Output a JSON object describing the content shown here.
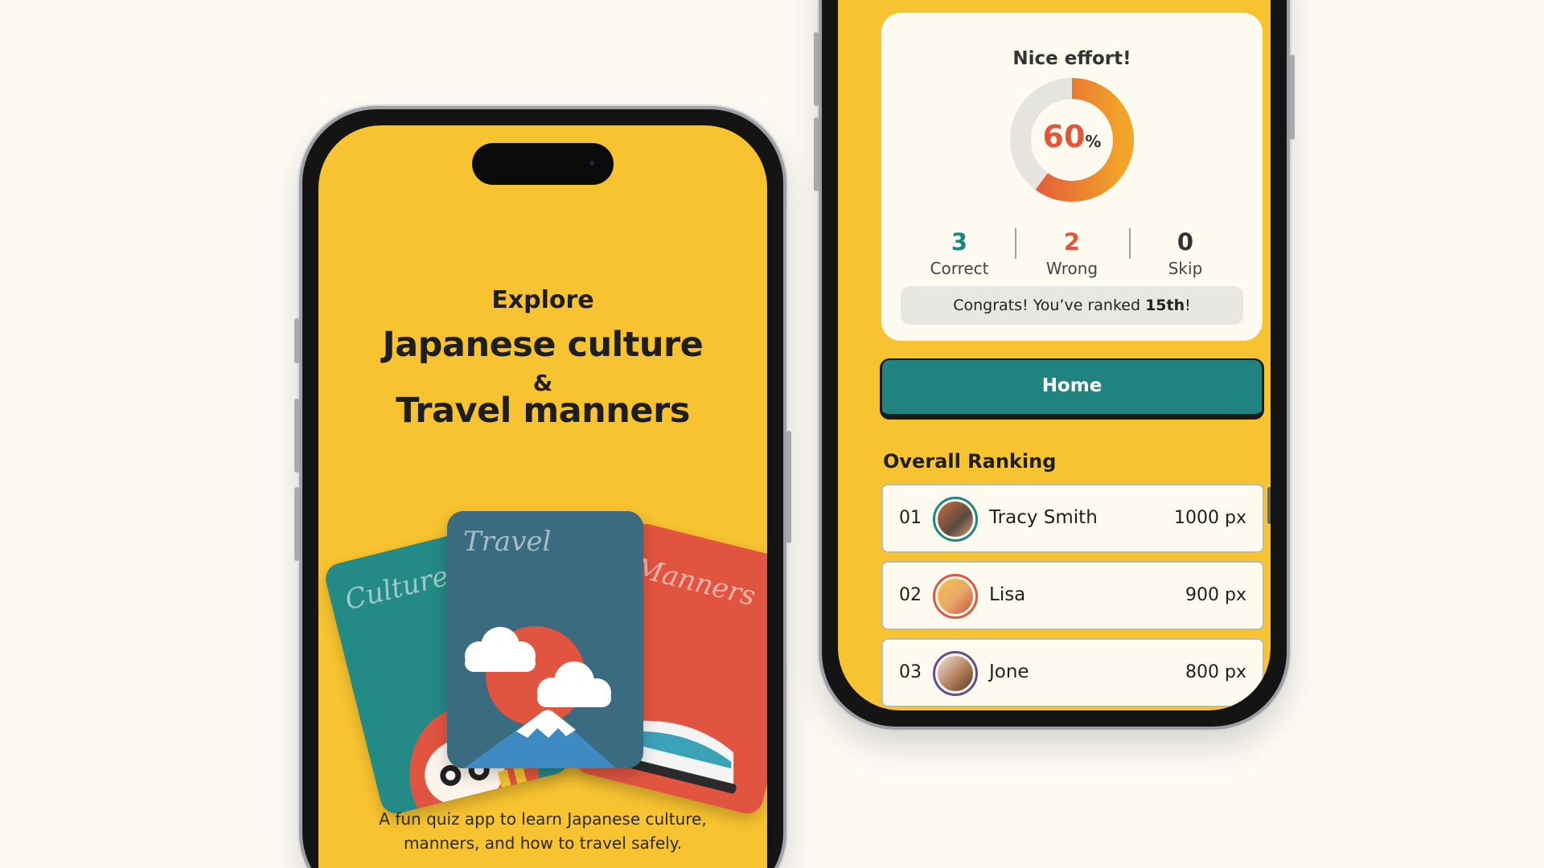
{
  "intro": {
    "line1": "Explore",
    "line2": "Japanese culture",
    "amp": "&",
    "line3": "Travel manners",
    "tagline_1": "A fun quiz app to learn Japanese culture,",
    "tagline_2": "manners, and how to travel safely."
  },
  "cards": [
    {
      "title": "Cultures",
      "color": "#238a85"
    },
    {
      "title": "Travel",
      "color": "#3a6b80"
    },
    {
      "title": "Manners",
      "color": "#e15440"
    }
  ],
  "result": {
    "title": "Nice effort!",
    "score": 60,
    "score_text": "60",
    "score_unit": "%",
    "stats": [
      {
        "value": "3",
        "label": "Correct",
        "color": "#1f8580"
      },
      {
        "value": "2",
        "label": "Wrong",
        "color": "#e2573c"
      },
      {
        "value": "0",
        "label": "Skip",
        "color": "#333333"
      }
    ],
    "congrats_prefix": "Congrats! You’ve ranked ",
    "congrats_rank": "15th",
    "congrats_suffix": "!"
  },
  "home_button": "Home",
  "ranking": {
    "title": "Overall Ranking",
    "rows": [
      {
        "rank": "01",
        "name": "Tracy Smith",
        "score": "1000 px",
        "ring": "#1f8580"
      },
      {
        "rank": "02",
        "name": "Lisa",
        "score": "900 px",
        "ring": "#e2573c"
      },
      {
        "rank": "03",
        "name": "Jone",
        "score": "800 px",
        "ring": "#6b4a8a"
      }
    ]
  },
  "colors": {
    "accent_yellow": "#f8c330",
    "teal": "#21837f",
    "red": "#e2573c",
    "cream": "#fdfaf0"
  }
}
